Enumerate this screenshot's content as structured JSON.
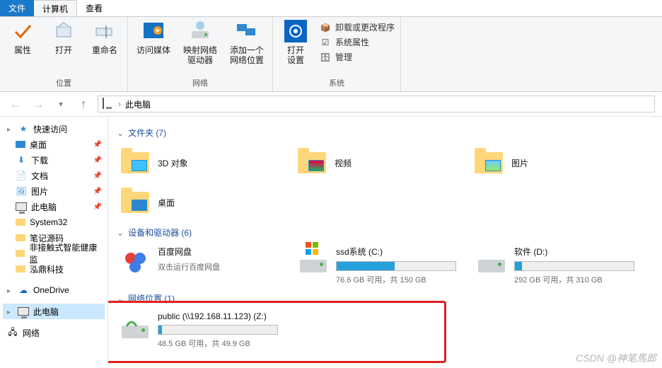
{
  "tabs": {
    "file": "文件",
    "computer": "计算机",
    "view": "查看"
  },
  "ribbon": {
    "group_location": {
      "label": "位置",
      "properties": "属性",
      "open": "打开",
      "rename": "重命名"
    },
    "group_network": {
      "label": "网络",
      "access_media": "访问媒体",
      "map_drive": "映射网络\n驱动器",
      "add_location": "添加一个\n网络位置"
    },
    "group_system": {
      "label": "系统",
      "open_settings": "打开\n设置",
      "uninstall": "卸载或更改程序",
      "sys_props": "系统属性",
      "manage": "管理"
    }
  },
  "breadcrumb": {
    "this_pc": "此电脑"
  },
  "sidebar": {
    "quick_access": "快速访问",
    "items": [
      {
        "label": "桌面",
        "pin": true
      },
      {
        "label": "下载",
        "pin": true
      },
      {
        "label": "文档",
        "pin": true
      },
      {
        "label": "图片",
        "pin": true
      },
      {
        "label": "此电脑",
        "pin": true
      },
      {
        "label": "System32",
        "pin": false
      },
      {
        "label": "笔记源码",
        "pin": false
      },
      {
        "label": "非接触式智能健康监",
        "pin": false
      },
      {
        "label": "泓鼎科技",
        "pin": false
      }
    ],
    "onedrive": "OneDrive",
    "this_pc": "此电脑",
    "network": "网络"
  },
  "sections": {
    "folders_h": "文件夹 (7)",
    "folders": [
      {
        "label": "3D 对象"
      },
      {
        "label": "视频"
      },
      {
        "label": "图片"
      },
      {
        "label": "桌面"
      }
    ],
    "drives_h": "设备和驱动器 (6)",
    "drives": [
      {
        "title": "百度网盘",
        "sub": "双击运行百度网盘",
        "bar": null
      },
      {
        "title": "ssd系统 (C:)",
        "sub": "76.6 GB 可用，共 150 GB",
        "pct": 49
      },
      {
        "title": "软件 (D:)",
        "sub": "292 GB 可用，共 310 GB",
        "pct": 6
      }
    ],
    "netloc_h": "网络位置 (1)",
    "netloc": [
      {
        "title": "public (\\\\192.168.11.123) (Z:)",
        "sub": "48.5 GB 可用，共 49.9 GB",
        "pct": 3
      }
    ]
  },
  "watermark": "CSDN @神笔馬郎"
}
